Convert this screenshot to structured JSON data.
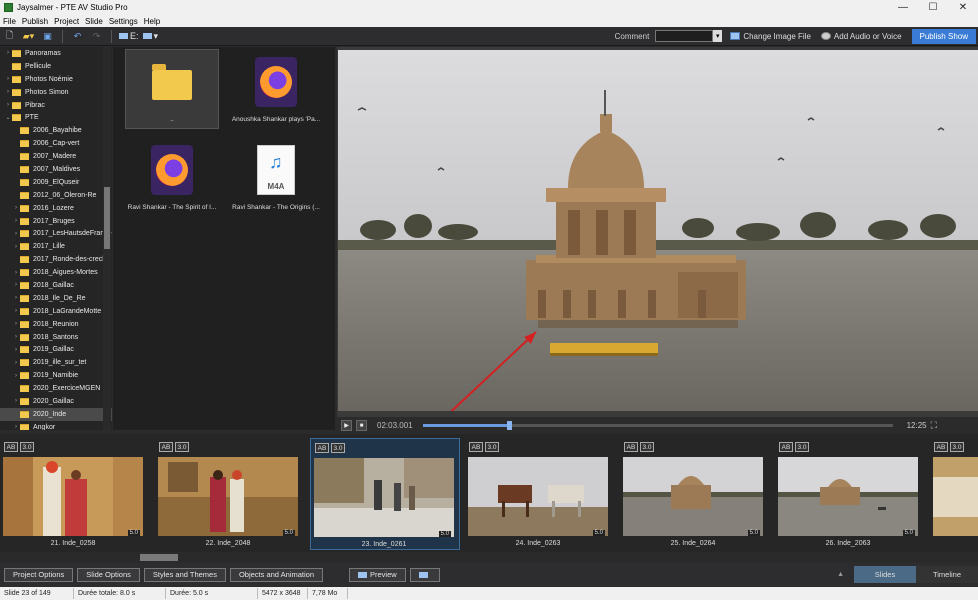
{
  "window": {
    "title": "Jaysalmer - PTE AV Studio Pro"
  },
  "menu": [
    "File",
    "Publish",
    "Project",
    "Slide",
    "Settings",
    "Help"
  ],
  "toolbar": {
    "drive_label": "E:",
    "comment_label": "Comment",
    "comment_value": "",
    "change_image_label": "Change Image File",
    "add_audio_label": "Add Audio or Voice",
    "publish_label": "Publish Show"
  },
  "tree": [
    {
      "label": "Panoramas",
      "arrow": "›",
      "indent": 1
    },
    {
      "label": "Pellicule",
      "arrow": "",
      "indent": 1
    },
    {
      "label": "Photos Noémie",
      "arrow": "›",
      "indent": 1
    },
    {
      "label": "Photos Simon",
      "arrow": "›",
      "indent": 1
    },
    {
      "label": "Pibrac",
      "arrow": "›",
      "indent": 1
    },
    {
      "label": "PTE",
      "arrow": "⌄",
      "indent": 1
    },
    {
      "label": "2006_Bayahibe",
      "arrow": "",
      "indent": 2
    },
    {
      "label": "2006_Cap-vert",
      "arrow": "",
      "indent": 2
    },
    {
      "label": "2007_Madere",
      "arrow": "",
      "indent": 2
    },
    {
      "label": "2007_Maldives",
      "arrow": "",
      "indent": 2
    },
    {
      "label": "2009_ElQuseir",
      "arrow": "",
      "indent": 2
    },
    {
      "label": "2012_06_Oleron-Re",
      "arrow": "",
      "indent": 2
    },
    {
      "label": "2016_Lozere",
      "arrow": "›",
      "indent": 2
    },
    {
      "label": "2017_Bruges",
      "arrow": "›",
      "indent": 2
    },
    {
      "label": "2017_LesHautsdeFrance",
      "arrow": "›",
      "indent": 2
    },
    {
      "label": "2017_Lille",
      "arrow": "›",
      "indent": 2
    },
    {
      "label": "2017_Ronde-des-creche",
      "arrow": "",
      "indent": 2
    },
    {
      "label": "2018_Aigues-Mortes",
      "arrow": "›",
      "indent": 2
    },
    {
      "label": "2018_Gaillac",
      "arrow": "›",
      "indent": 2
    },
    {
      "label": "2018_Ile_De_Re",
      "arrow": "›",
      "indent": 2
    },
    {
      "label": "2018_LaGrandeMotte",
      "arrow": "›",
      "indent": 2
    },
    {
      "label": "2018_Reunion",
      "arrow": "›",
      "indent": 2
    },
    {
      "label": "2018_Santons",
      "arrow": "›",
      "indent": 2
    },
    {
      "label": "2019_Gaillac",
      "arrow": "›",
      "indent": 2
    },
    {
      "label": "2019_ille_sur_tet",
      "arrow": "›",
      "indent": 2
    },
    {
      "label": "2019_Namibie",
      "arrow": "›",
      "indent": 2
    },
    {
      "label": "2020_ExerciceMGEN",
      "arrow": "",
      "indent": 2
    },
    {
      "label": "2020_Gaillac",
      "arrow": "›",
      "indent": 2
    },
    {
      "label": "2020_Inde",
      "arrow": "",
      "indent": 2,
      "selected": true
    },
    {
      "label": "Angkor",
      "arrow": "›",
      "indent": 2
    }
  ],
  "files": [
    {
      "label": "..",
      "type": "folder"
    },
    {
      "label": "Anoushka Shankar plays 'Pa...",
      "type": "firefox"
    },
    {
      "label": "Ravi Shankar - The Spirit of I...",
      "type": "firefox"
    },
    {
      "label": "Ravi Shankar - The Origins (...",
      "type": "m4a",
      "badge": "M4A"
    }
  ],
  "player": {
    "current_time": "02:03.001",
    "total_time": "12:25",
    "progress": 0.183
  },
  "slides": [
    {
      "label": "21. Inde_0258",
      "ab": "AB",
      "time": "3.0",
      "duration": "5.0",
      "scene": "couple"
    },
    {
      "label": "22. Inde_2048",
      "ab": "AB",
      "time": "3.0",
      "duration": "5.0",
      "scene": "dance"
    },
    {
      "label": "23. Inde_0261",
      "ab": "AB",
      "time": "3.0",
      "duration": "5.0",
      "scene": "street",
      "selected": true
    },
    {
      "label": "24. Inde_0263",
      "ab": "AB",
      "time": "3.0",
      "duration": "5.0",
      "scene": "cows"
    },
    {
      "label": "25. Inde_0264",
      "ab": "AB",
      "time": "3.0",
      "duration": "5.0",
      "scene": "lake"
    },
    {
      "label": "26. Inde_2063",
      "ab": "AB",
      "time": "3.0",
      "duration": "5.0",
      "scene": "lake2"
    },
    {
      "label": "",
      "ab": "AB",
      "time": "3.0",
      "duration": "",
      "scene": "partial"
    }
  ],
  "bottom": {
    "project_options": "Project Options",
    "slide_options": "Slide Options",
    "styles_themes": "Styles and Themes",
    "objects_animation": "Objects and Animation",
    "preview": "Preview",
    "slides_tab": "Slides",
    "timeline_tab": "Timeline"
  },
  "status": {
    "slide_of": "Slide 23 of 149",
    "total_duration": "Durée totale: 8.0 s",
    "duration": "Durée: 5.0 s",
    "dimensions": "5472 x 3648",
    "size": "7,78 Mo"
  },
  "colors": {
    "accent": "#3a7bd5",
    "arrow": "#d42020",
    "folder": "#f3c94d"
  }
}
